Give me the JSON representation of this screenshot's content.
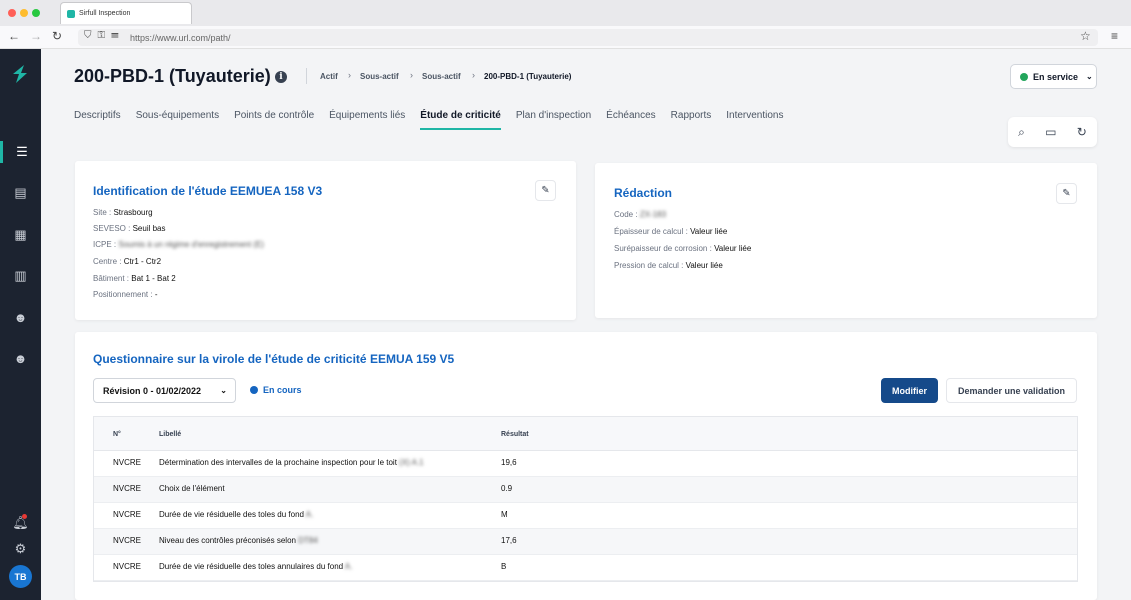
{
  "browser": {
    "tab_title": "Sirfull Inspection",
    "url": "https://www.url.com/path/"
  },
  "sidebar": {
    "avatar_initials": "TB"
  },
  "header": {
    "title": "200-PBD-1 (Tuyauterie)",
    "info_glyph": "i",
    "breadcrumb": [
      "Actif",
      "Sous-actif",
      "Sous-actif",
      "200-PBD-1 (Tuyauterie)"
    ],
    "status": "En service"
  },
  "tabs": [
    "Descriptifs",
    "Sous-équipements",
    "Points de contrôle",
    "Équipements liés",
    "Étude de criticité",
    "Plan d'inspection",
    "Échéances",
    "Rapports",
    "Interventions"
  ],
  "identification": {
    "title": "Identification de l'étude EEMUEA 158 V3",
    "fields": [
      {
        "label": "Site :",
        "value": "Strasbourg"
      },
      {
        "label": "SEVESO :",
        "value": "Seuil bas"
      },
      {
        "label": "ICPE :",
        "value": "Soumis à un régime d'enregistrement (E)"
      },
      {
        "label": "Centre :",
        "value": "Ctr1 - Ctr2"
      },
      {
        "label": "Bâtiment :",
        "value": "Bat 1 - Bat 2"
      },
      {
        "label": "Positionnement :",
        "value": "-"
      }
    ]
  },
  "redaction": {
    "title": "Rédaction",
    "fields": [
      {
        "label": "Code :",
        "value": "ZX-183"
      },
      {
        "label": "Épaisseur de calcul :",
        "value": "Valeur liée"
      },
      {
        "label": "Surépaisseur de corrosion :",
        "value": "Valeur liée"
      },
      {
        "label": "Pression de calcul :",
        "value": "Valeur liée"
      }
    ]
  },
  "questionnaire": {
    "title": "Questionnaire sur la virole de l'étude de criticité EEMUA 159 V5",
    "revision": "Révision 0 - 01/02/2022",
    "state": "En cours",
    "modify_label": "Modifier",
    "validation_label": "Demander une validation",
    "columns": [
      "N°",
      "Libellé",
      "Résultat"
    ],
    "rows": [
      {
        "n": "NVCRE",
        "label": "Détermination des intervalles de la prochaine inspection pour le toit",
        "label_blur": "(X) A.1",
        "result": "19,6"
      },
      {
        "n": "NVCRE",
        "label": "Choix de l'élément",
        "label_blur": "",
        "result": "0.9"
      },
      {
        "n": "NVCRE",
        "label": "Durée de vie résiduelle des toles du fond",
        "label_blur": "A.",
        "result": "M"
      },
      {
        "n": "NVCRE",
        "label": "Niveau des contrôles préconisés selon",
        "label_blur": "DT84",
        "result": "17,6"
      },
      {
        "n": "NVCRE",
        "label": "Durée de vie résiduelle des toles annulaires du fond",
        "label_blur": "A.",
        "result": "B"
      }
    ]
  }
}
